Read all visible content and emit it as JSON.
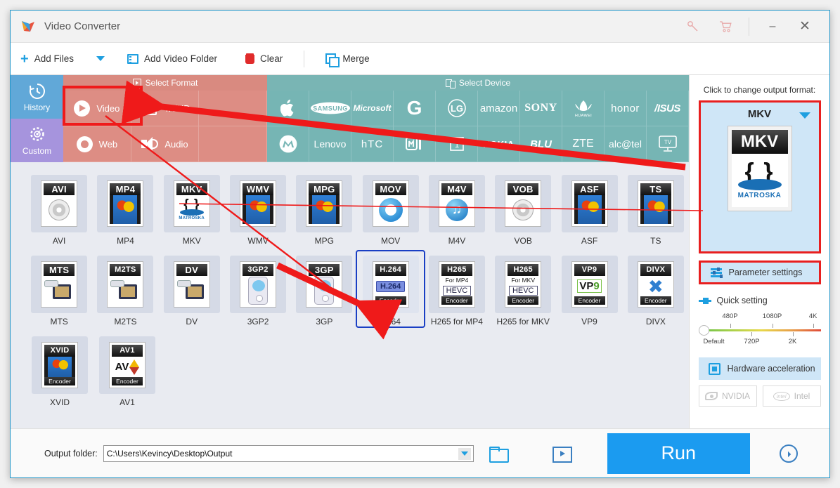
{
  "window": {
    "title": "Video Converter",
    "controls": {
      "key": "key-icon",
      "cart": "cart-icon",
      "minimize": "–",
      "close": "✕"
    }
  },
  "toolbar": {
    "add_files": "Add Files",
    "add_video_folder": "Add Video Folder",
    "clear": "Clear",
    "merge": "Merge"
  },
  "side_categories": [
    {
      "label": "History",
      "icon": "history-clock-icon"
    },
    {
      "label": "Custom",
      "icon": "gear-icon"
    }
  ],
  "panels": {
    "format_header": "Select Format",
    "device_header": "Select Device"
  },
  "format_categories": [
    {
      "label": "Video",
      "icon": "play-circle-icon",
      "selected": true
    },
    {
      "label": "4K/HD",
      "icon": "screen-icon",
      "selected": false
    },
    {
      "label": "Web",
      "icon": "chrome-icon",
      "selected": false
    },
    {
      "label": "Audio",
      "icon": "speaker-icon",
      "selected": false
    }
  ],
  "devices": [
    "Apple",
    "SAMSUNG",
    "Microsoft",
    "G",
    "LG",
    "amazon",
    "SONY",
    "HUAWEI",
    "honor",
    "ASUS",
    "Motorola",
    "Lenovo",
    "HTC",
    "MI",
    "1+",
    "NOKIA",
    "BLU",
    "ZTE",
    "alcatel",
    "TV"
  ],
  "formats": [
    {
      "label": "AVI",
      "badge": "AVI",
      "art": "disc-film",
      "sub": "",
      "foot": ""
    },
    {
      "label": "MP4",
      "badge": "MP4",
      "art": "balloon",
      "sub": "",
      "foot": ""
    },
    {
      "label": "MKV",
      "badge": "MKV",
      "art": "matroska",
      "sub": "",
      "foot": ""
    },
    {
      "label": "WMV",
      "badge": "WMV",
      "art": "balloon",
      "sub": "",
      "foot": ""
    },
    {
      "label": "MPG",
      "badge": "MPG",
      "art": "balloon",
      "sub": "",
      "foot": ""
    },
    {
      "label": "MOV",
      "badge": "MOV",
      "art": "quicktime",
      "sub": "",
      "foot": ""
    },
    {
      "label": "M4V",
      "badge": "M4V",
      "art": "note",
      "sub": "",
      "foot": ""
    },
    {
      "label": "VOB",
      "badge": "VOB",
      "art": "disc-film",
      "sub": "",
      "foot": ""
    },
    {
      "label": "ASF",
      "badge": "ASF",
      "art": "balloon",
      "sub": "",
      "foot": ""
    },
    {
      "label": "TS",
      "badge": "TS",
      "art": "balloon",
      "sub": "",
      "foot": ""
    },
    {
      "label": "MTS",
      "badge": "MTS",
      "art": "camcorder",
      "sub": "",
      "foot": ""
    },
    {
      "label": "M2TS",
      "badge": "M2TS",
      "art": "camcorder",
      "sub": "",
      "foot": ""
    },
    {
      "label": "DV",
      "badge": "DV",
      "art": "camcorder",
      "sub": "",
      "foot": ""
    },
    {
      "label": "3GP2",
      "badge": "3GP2",
      "art": "mp3player",
      "sub": "",
      "foot": ""
    },
    {
      "label": "3GP",
      "badge": "3GP",
      "art": "mp3player",
      "sub": "",
      "foot": ""
    },
    {
      "label": "H264",
      "badge": "H.264",
      "art": "h264",
      "sub": "",
      "foot": "Encoder",
      "selected": true
    },
    {
      "label": "H265 for MP4",
      "badge": "H265",
      "art": "hevc",
      "sub": "For MP4",
      "foot": "Encoder"
    },
    {
      "label": "H265 for MKV",
      "badge": "H265",
      "art": "hevc",
      "sub": "For MKV",
      "foot": "Encoder"
    },
    {
      "label": "VP9",
      "badge": "VP9",
      "art": "vp9",
      "sub": "",
      "foot": "Encoder"
    },
    {
      "label": "DIVX",
      "badge": "DIVX",
      "art": "divx",
      "sub": "",
      "foot": "Encoder"
    },
    {
      "label": "XVID",
      "badge": "XVID",
      "art": "balloon",
      "sub": "",
      "foot": "Encoder"
    },
    {
      "label": "AV1",
      "badge": "AV1",
      "art": "av1",
      "sub": "",
      "foot": "Encoder"
    }
  ],
  "right_panel": {
    "hint": "Click to change output format:",
    "output_format": "MKV",
    "output_icon_header": "MKV",
    "output_icon_text": "MATROSKA",
    "parameter_settings": "Parameter settings",
    "quick_setting": "Quick setting",
    "slider": {
      "top_labels": [
        "480P",
        "1080P",
        "4K"
      ],
      "bottom_labels": [
        "Default",
        "720P",
        "2K"
      ],
      "value": "Default"
    },
    "hardware_acceleration": "Hardware acceleration",
    "gpu_options": [
      "NVIDIA",
      "Intel"
    ]
  },
  "bottom": {
    "output_folder_label": "Output folder:",
    "output_folder_value": "C:\\Users\\Kevincy\\Desktop\\Output",
    "run_label": "Run"
  },
  "colors": {
    "accent_blue": "#1b9bf0",
    "format_red": "#dd8d84",
    "device_teal": "#76b5b4",
    "history_blue": "#61a8d8",
    "custom_purple": "#a694dd",
    "annotation_red": "#ef1a1a",
    "selected_border": "#1a3fc4"
  }
}
